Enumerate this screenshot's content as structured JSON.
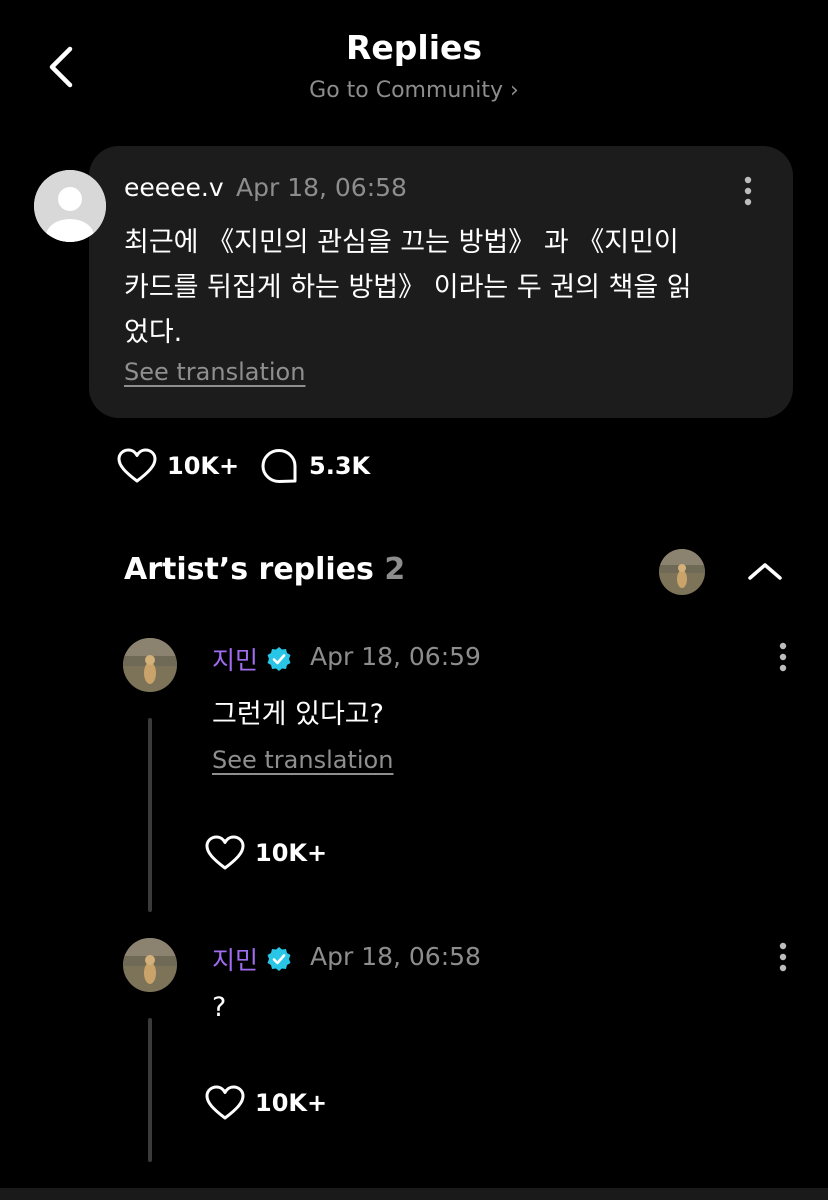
{
  "header": {
    "title": "Replies",
    "community_link": "Go to Community ›"
  },
  "post": {
    "username": "eeeee.v",
    "timestamp": "Apr 18, 06:58",
    "text": "최근에 《지민의 관심을 끄는 방법》 과 《지민이\n카드를 뒤집게 하는 방법》 이라는 두 권의 책을 읽\n었다.",
    "see_translation": "See translation",
    "likes": "10K+",
    "comments": "5.3K"
  },
  "artist_replies": {
    "label": "Artist’s replies",
    "count": "2",
    "replies": [
      {
        "name": "지민",
        "timestamp": "Apr 18, 06:59",
        "text": "그런게 있다고?",
        "see_translation": "See translation",
        "likes": "10K+"
      },
      {
        "name": "지민",
        "timestamp": "Apr 18, 06:58",
        "text": "?",
        "likes": "10K+"
      }
    ]
  },
  "colors": {
    "background": "#000000",
    "card": "#1c1c1c",
    "artist_name": "#a06cf0",
    "verified_badge": "#29c5e6",
    "muted_text": "#8d8d8d"
  },
  "icons": [
    "back-chevron-icon",
    "chevron-right-icon",
    "more-vertical-icon",
    "heart-icon",
    "comment-bubble-icon",
    "chevron-up-icon",
    "verified-badge-icon"
  ]
}
